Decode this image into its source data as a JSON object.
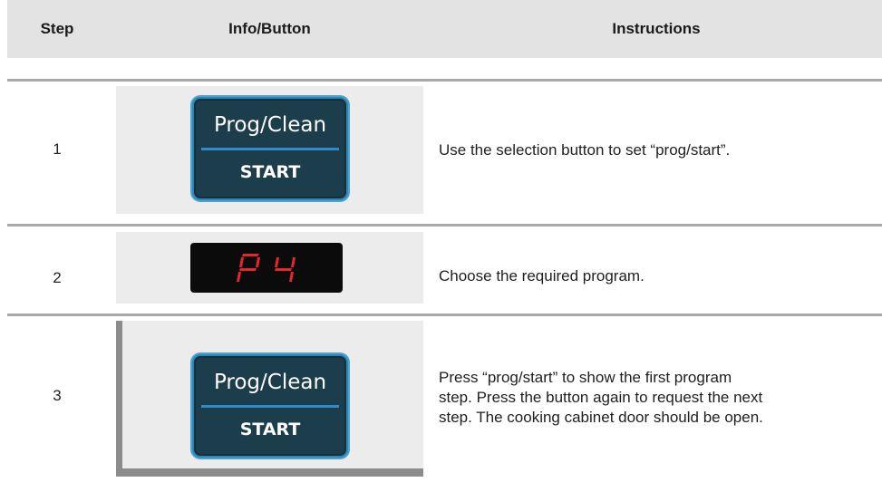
{
  "table": {
    "headers": {
      "step": "Step",
      "info": "Info/Button",
      "instructions": "Instructions"
    },
    "rows": [
      {
        "step": "1",
        "button": {
          "top": "Prog/Clean",
          "bottom": "START"
        },
        "instruction": "Use the selection button to set “prog/start”."
      },
      {
        "step": "2",
        "display": "P4",
        "instruction": "Choose the required program."
      },
      {
        "step": "3",
        "button": {
          "top": "Prog/Clean",
          "bottom": "START"
        },
        "instruction_lines": [
          "Press “prog/start” to show the first program",
          "step. Press the button again to request the next",
          "step. The cooking cabinet door should be open."
        ]
      }
    ]
  },
  "colors": {
    "header_bg": "#e3e3e3",
    "button_bg": "#1c3d4b",
    "button_border": "#2f86b6",
    "display_digits": "#e8262a"
  }
}
